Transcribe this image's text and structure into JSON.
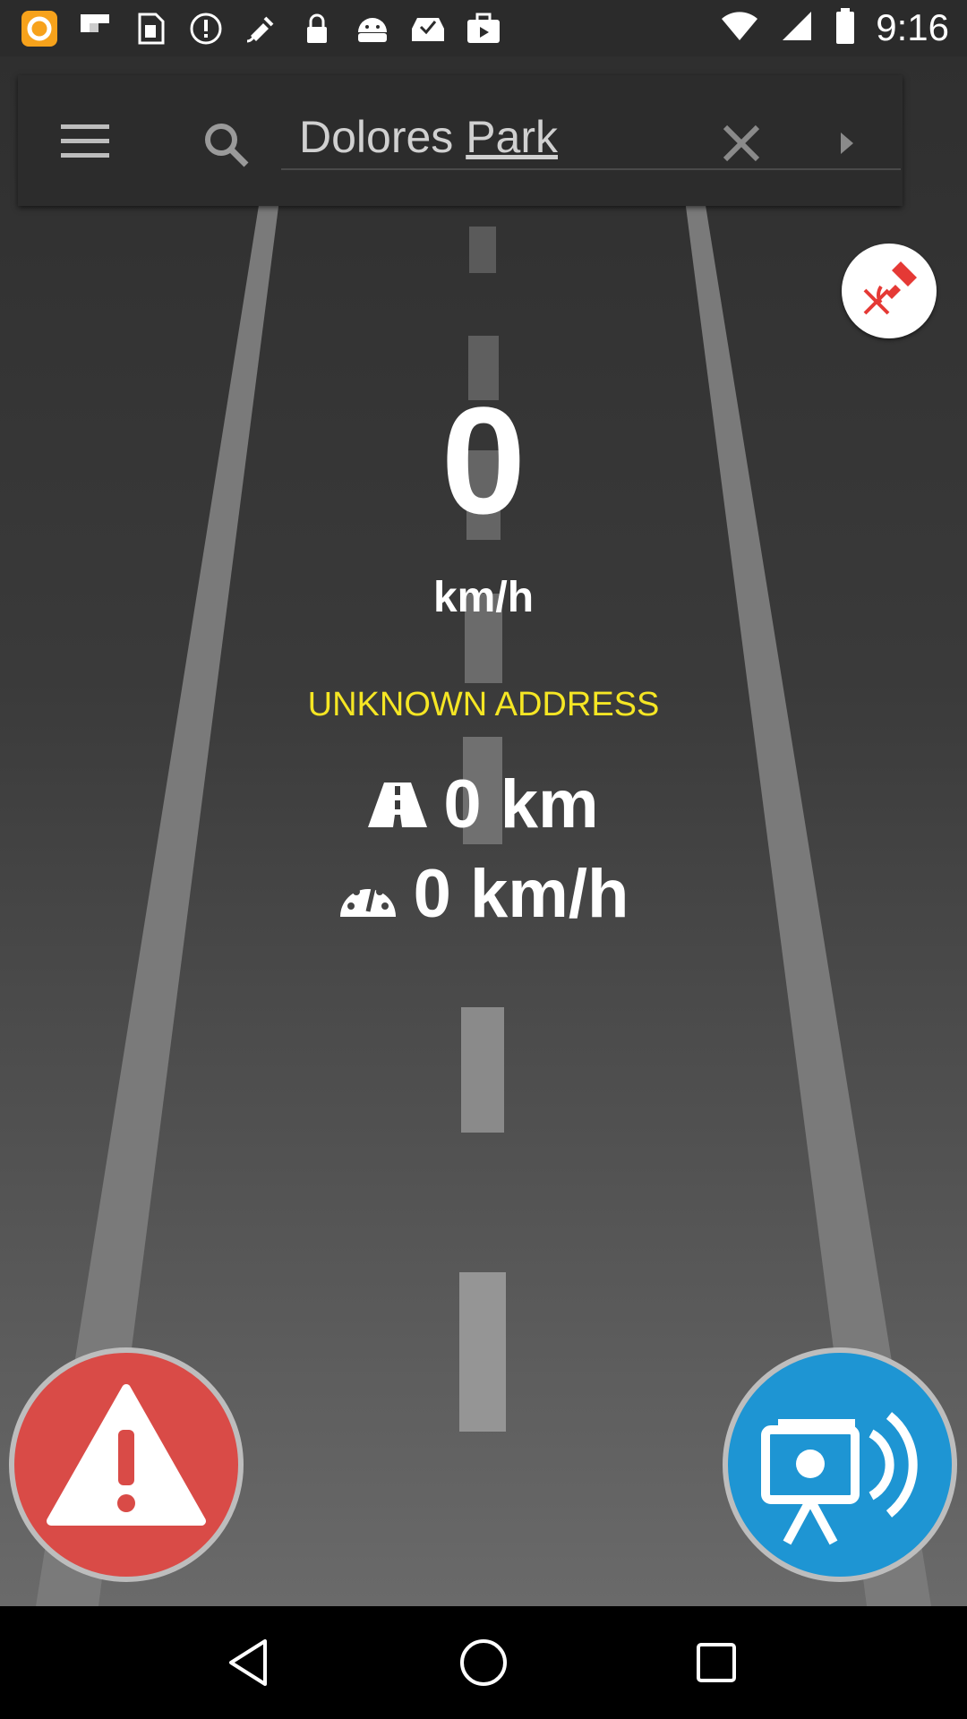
{
  "status_bar": {
    "time": "9:16",
    "icons": [
      "app-logo-icon",
      "flipboard-icon",
      "sim-card-icon",
      "alert-circle-icon",
      "fake-gps-icon",
      "lock-icon",
      "android-icon",
      "inbox-check-icon",
      "briefcase-icon"
    ],
    "right_icons": [
      "wifi-icon",
      "signal-icon",
      "battery-icon"
    ]
  },
  "search": {
    "value_plain": "Dolores ",
    "value_underlined": "Park"
  },
  "speed": {
    "value": "0",
    "unit": "km/h"
  },
  "address": "UNKNOWN ADDRESS",
  "stats": {
    "distance": "0 km",
    "avg_speed": "0 km/h"
  },
  "colors": {
    "address_yellow": "#f5e624",
    "alert_red": "#d94b47",
    "camera_blue": "#1e95d3"
  },
  "nav": [
    "back-icon",
    "home-icon",
    "recents-icon"
  ]
}
